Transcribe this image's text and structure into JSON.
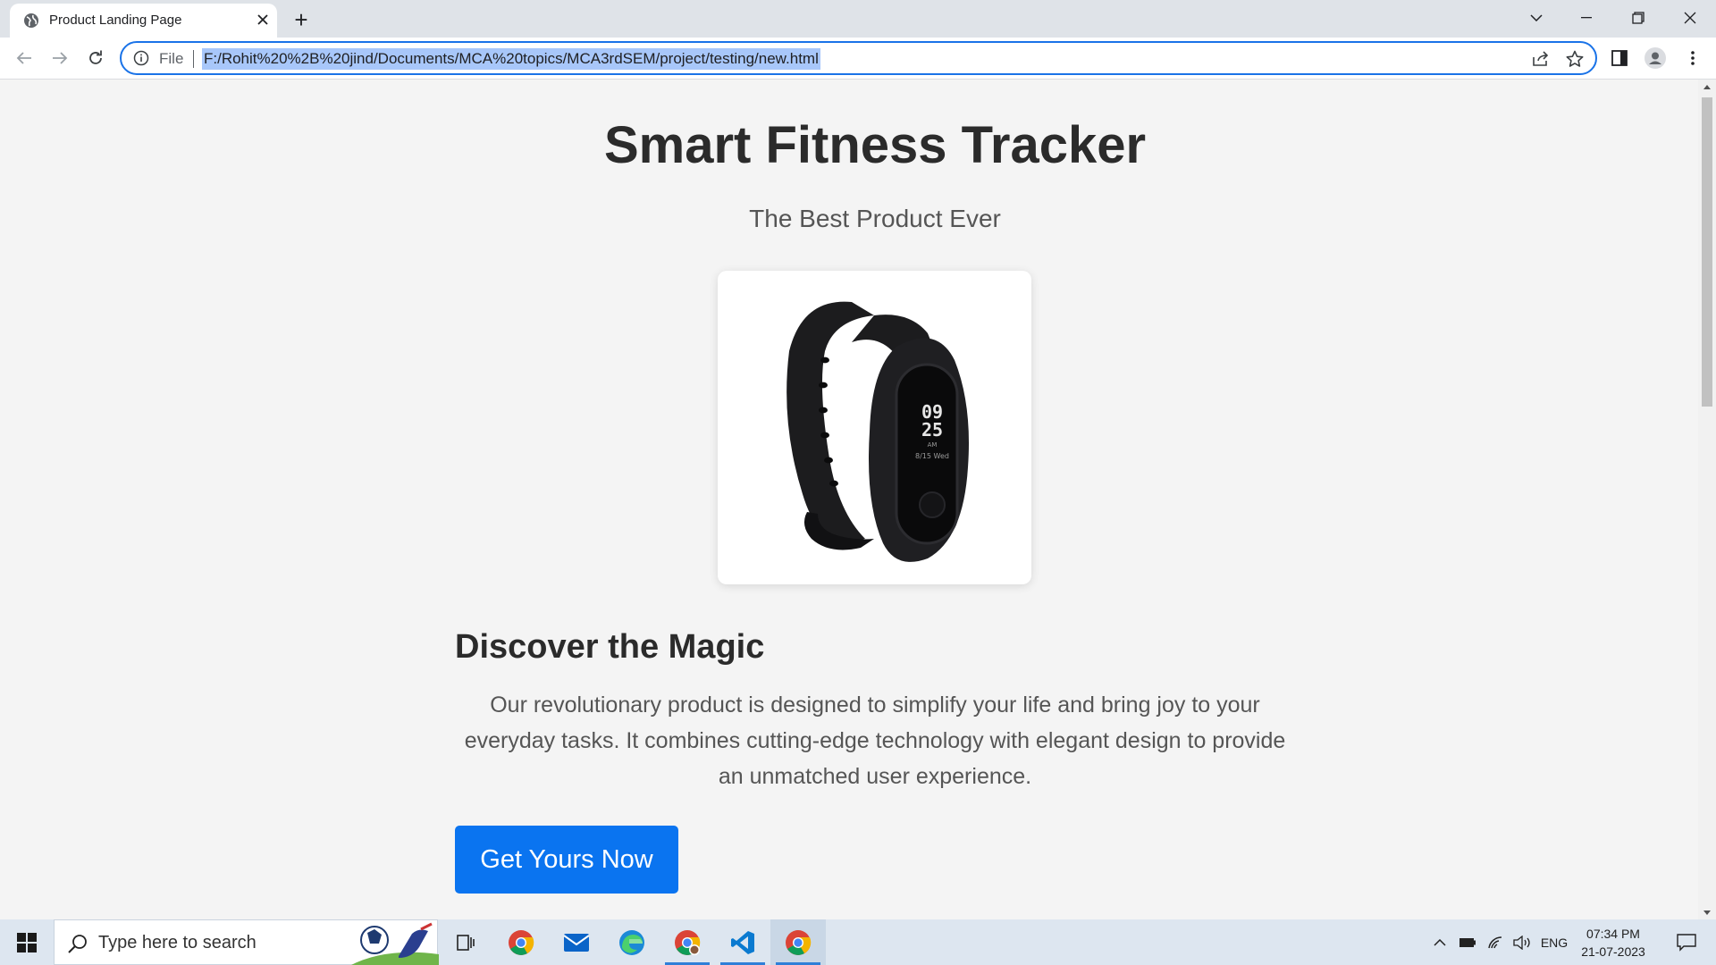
{
  "browser": {
    "tab_title": "Product Landing Page",
    "new_tab_label": "+",
    "omnibox": {
      "scheme_label": "File",
      "url": "F:/Rohit%20%2B%20jind/Documents/MCA%20topics/MCA3rdSEM/project/testing/new.html"
    }
  },
  "page": {
    "title": "Smart Fitness Tracker",
    "subtitle": "The Best Product Ever",
    "product_image": {
      "display_time_hours": "09",
      "display_time_minutes": "25",
      "display_ampm": "AM",
      "display_date": "8/15 Wed"
    },
    "section_heading": "Discover the Magic",
    "description": "Our revolutionary product is designed to simplify your life and bring joy to your everyday tasks. It combines cutting-edge technology with elegant design to provide an unmatched user experience.",
    "cta_label": "Get Yours Now"
  },
  "taskbar": {
    "search_placeholder": "Type here to search",
    "language": "ENG",
    "time": "07:34 PM",
    "date": "21-07-2023",
    "apps": [
      "task-view-icon",
      "chrome-icon",
      "mail-icon",
      "edge-icon",
      "chrome-profile-icon",
      "vscode-icon",
      "chrome-active-icon"
    ]
  },
  "colors": {
    "accent": "#0a74f0",
    "omnibox_focus": "#1a73e8",
    "url_selection": "#a8c7fa",
    "page_bg": "#f4f4f4"
  }
}
